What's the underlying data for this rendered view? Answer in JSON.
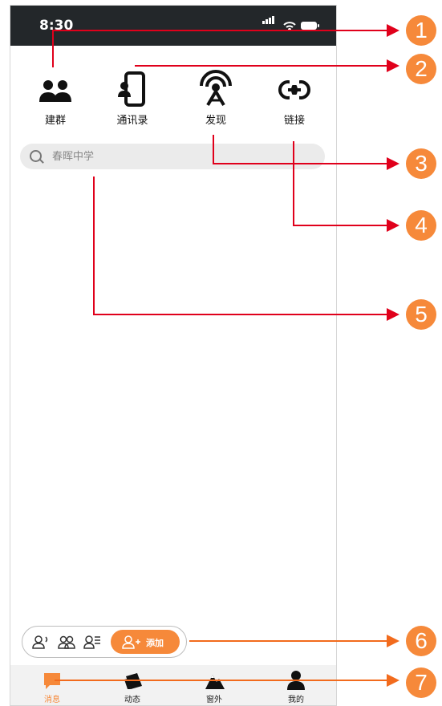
{
  "status_bar": {
    "time": "8:30"
  },
  "actions": [
    {
      "label": "建群",
      "icon": "group-icon"
    },
    {
      "label": "通讯录",
      "icon": "contacts-phone-icon"
    },
    {
      "label": "发现",
      "icon": "broadcast-antenna-icon"
    },
    {
      "label": "链接",
      "icon": "link-icon"
    }
  ],
  "search": {
    "placeholder": "春晖中学",
    "icon": "search-icon"
  },
  "quick_bar": {
    "add_label": "添加",
    "icons": [
      "voice-contact-icon",
      "group-contact-icon",
      "contact-list-icon",
      "add-contact-icon"
    ]
  },
  "tabs": [
    {
      "label": "消息",
      "icon": "message-icon",
      "active": true
    },
    {
      "label": "动态",
      "icon": "feed-icon",
      "active": false
    },
    {
      "label": "窗外",
      "icon": "mountain-icon",
      "active": false
    },
    {
      "label": "我的",
      "icon": "profile-icon",
      "active": false
    }
  ],
  "annotations": [
    "1",
    "2",
    "3",
    "4",
    "5",
    "6",
    "7"
  ],
  "colors": {
    "accent": "#f6893a",
    "arrow_red": "#e0001b",
    "arrow_orange": "#f26b1d",
    "status_bar": "#23272a"
  }
}
